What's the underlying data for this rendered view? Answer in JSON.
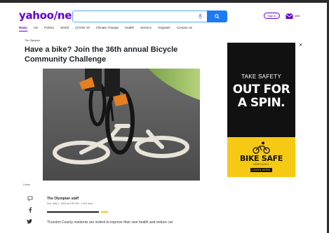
{
  "header": {
    "logo": "yahoo/news",
    "search_placeholder": "",
    "signin_label": "Sign in",
    "mail_label": "Mail"
  },
  "nav": [
    "News",
    "US",
    "Politics",
    "World",
    "COVID-19",
    "Climate Change",
    "Health",
    "Science",
    "Originals",
    "Contact Us"
  ],
  "article": {
    "publisher": "The Olympian",
    "headline": "Have a bike? Join the 36th annual Bicycle Community Challenge",
    "comments_label": "Comm",
    "byline": "The Olympian staff",
    "date": "Sun, May 1, 2022 at 3:00 PM · 1 min read",
    "lede": "Thurston County residents are invited to improve their own health and reduce car"
  },
  "ad": {
    "line1": "TAKE SAFETY",
    "line2": "OUT FOR",
    "line3": "A SPIN.",
    "brand": "BIKE SAFE",
    "brand_sub": "· KENTUCKY ·",
    "cta": "LEARN MORE",
    "close": "×"
  },
  "colors": {
    "brand_purple": "#6001d2",
    "search_blue": "#1a7af8",
    "ad_yellow": "#f6c915"
  }
}
